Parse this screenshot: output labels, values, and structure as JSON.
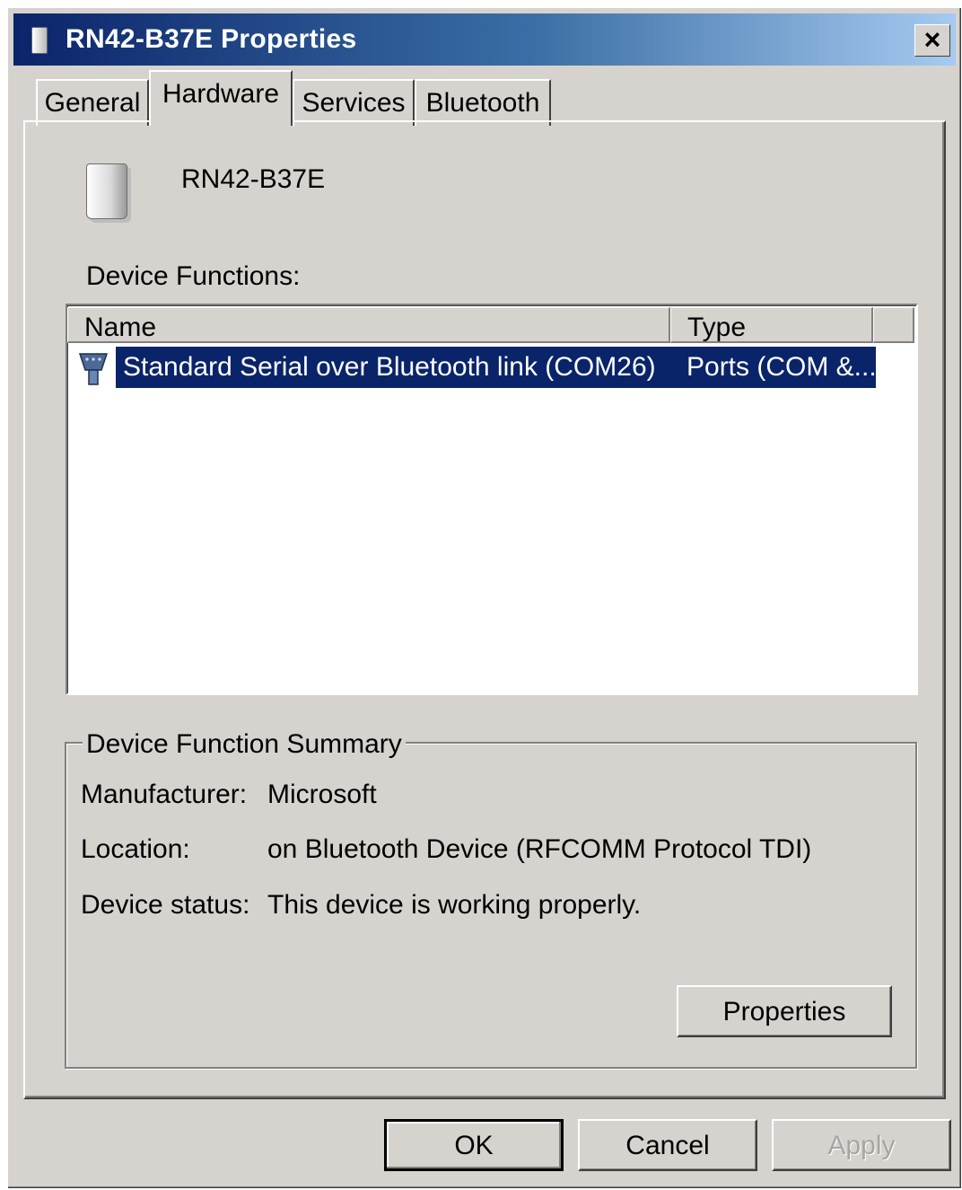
{
  "window": {
    "title": "RN42-B37E Properties",
    "close_label": "×"
  },
  "tabs": [
    {
      "label": "General"
    },
    {
      "label": "Hardware",
      "active": true
    },
    {
      "label": "Services"
    },
    {
      "label": "Bluetooth"
    }
  ],
  "device": {
    "name": "RN42-B37E",
    "icon": "bluetooth-device-icon"
  },
  "functions": {
    "label": "Device Functions:",
    "columns": [
      "Name",
      "Type"
    ],
    "rows": [
      {
        "name": "Standard Serial over Bluetooth link (COM26)",
        "type": "Ports (COM &...",
        "icon": "serial-port-icon",
        "selected": true
      }
    ]
  },
  "summary": {
    "title": "Device Function Summary",
    "manufacturer_label": "Manufacturer:",
    "manufacturer_value": "Microsoft",
    "location_label": "Location:",
    "location_value": "on Bluetooth Device (RFCOMM Protocol TDI)",
    "status_label": "Device status:",
    "status_value": "This device is working properly.",
    "properties_label": "Properties"
  },
  "buttons": {
    "ok": "OK",
    "cancel": "Cancel",
    "apply": "Apply"
  },
  "colors": {
    "titlebar_start": "#0b246a",
    "selection": "#0a246a",
    "face": "#d6d3ce"
  }
}
